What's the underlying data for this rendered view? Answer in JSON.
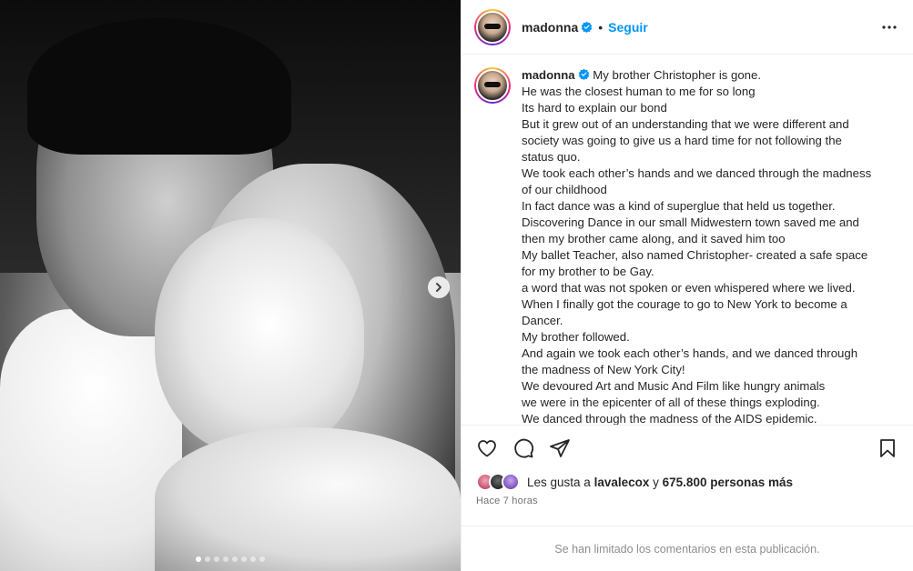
{
  "post": {
    "username": "madonna",
    "separator": "•",
    "follow_label": "Seguir",
    "caption_lines": [
      "My brother Christopher is gone.",
      "He was the closest human to me for so long",
      "Its hard to explain our bond",
      "But it grew out of an understanding that we were different and",
      "society was going to give us a hard time for not following the",
      "status quo.",
      "We took each other’s hands and we danced through the madness",
      "of our childhood",
      "In fact dance was a kind of superglue that held us together.",
      "Discovering Dance in our small Midwestern town saved me and",
      "then my brother came along, and it saved him too",
      "My ballet Teacher, also named Christopher- created a safe space",
      "for my brother to be Gay.",
      "a word that was not spoken or even whispered where we lived.",
      "When I finally got the courage to go to New York to become a",
      "Dancer.",
      "My brother followed.",
      "And again we took each other’s hands, and we danced through",
      "the madness of New York City!",
      "We devoured Art and Music And Film like hungry animals",
      "we were in the epicenter of all of these things exploding.",
      "We danced through the madness of the AIDS epidemic."
    ],
    "likes_prefix": "Les gusta a",
    "likes_user": "lavalecox",
    "likes_connector": "y",
    "likes_count": "675.800 personas más",
    "time_ago": "Hace 7 horas",
    "comments_notice": "Se han limitado los comentarios en esta publicación."
  },
  "icons": {
    "verified": "verified-badge-icon",
    "more": "more-options-icon",
    "like": "heart-icon",
    "comment": "comment-icon",
    "share": "paper-plane-icon",
    "save": "bookmark-icon",
    "next": "chevron-right-icon"
  },
  "colors": {
    "follow": "#0095f6",
    "verified": "#0095f6",
    "muted": "#8e8e8e"
  }
}
